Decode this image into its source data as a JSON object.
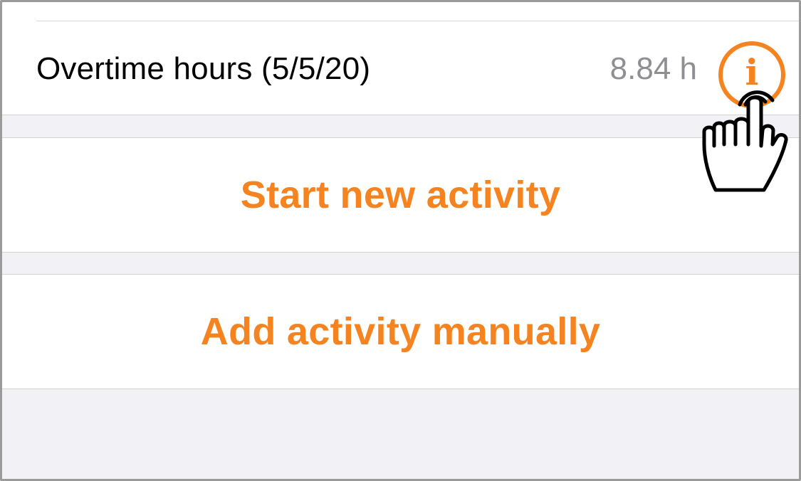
{
  "overtime": {
    "label": "Overtime hours (5/5/20)",
    "value": "8.84 h",
    "info_icon": "info-circle-icon"
  },
  "actions": {
    "start_label": "Start new activity",
    "add_label": "Add activity manually"
  },
  "cursor": {
    "icon": "hand-pointer-icon"
  },
  "colors": {
    "accent": "#f5831f",
    "secondary_text": "#8e8e93",
    "grouped_background": "#f1f1f6"
  }
}
